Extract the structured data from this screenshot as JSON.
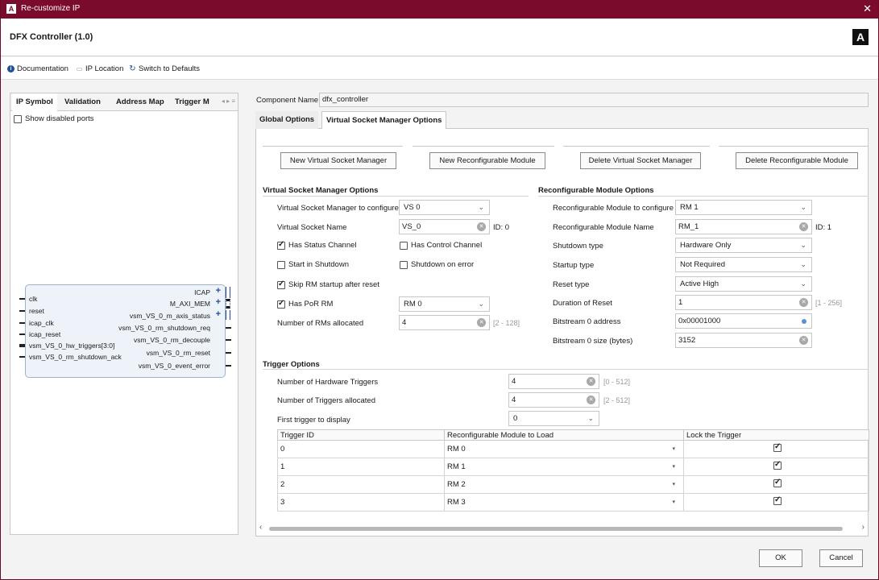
{
  "window": {
    "title": "Re-customize IP",
    "app_icon_glyph": "A"
  },
  "header": {
    "title": "DFX Controller (1.0)",
    "logo_glyph": "A"
  },
  "toolbar": {
    "documentation": "Documentation",
    "ip_location": "IP Location",
    "switch_defaults": "Switch to Defaults"
  },
  "left": {
    "tabs": [
      "IP Symbol",
      "Validation",
      "Address Map",
      "Trigger M"
    ],
    "show_disabled_ports": "Show disabled ports",
    "ports_left": [
      "clk",
      "reset",
      "icap_clk",
      "icap_reset",
      "vsm_VS_0_hw_triggers[3:0]",
      "vsm_VS_0_rm_shutdown_ack"
    ],
    "ports_right": [
      "ICAP",
      "M_AXI_MEM",
      "vsm_VS_0_m_axis_status",
      "vsm_VS_0_rm_shutdown_req",
      "vsm_VS_0_rm_decouple",
      "vsm_VS_0_rm_reset",
      "vsm_VS_0_event_error"
    ]
  },
  "right": {
    "component_name_label": "Component Name",
    "component_name_value": "dfx_controller",
    "tabs": [
      "Global Options",
      "Virtual Socket Manager Options"
    ],
    "buttons": [
      "New Virtual Socket Manager",
      "New Reconfigurable Module",
      "Delete Virtual Socket Manager",
      "Delete Reconfigurable Module"
    ],
    "vsm": {
      "title": "Virtual Socket Manager Options",
      "configure_label": "Virtual Socket Manager to configure",
      "configure_value": "VS 0",
      "name_label": "Virtual Socket Name",
      "name_value": "VS_0",
      "id_text": "ID: 0",
      "has_status_channel": "Has Status Channel",
      "has_control_channel": "Has Control Channel",
      "start_in_shutdown": "Start in Shutdown",
      "shutdown_on_error": "Shutdown on error",
      "skip_rm_startup": "Skip RM startup after reset",
      "has_por_rm": "Has PoR RM",
      "por_rm_value": "RM 0",
      "num_rms_label": "Number of RMs allocated",
      "num_rms_value": "4",
      "num_rms_hint": "[2 - 128]"
    },
    "rm": {
      "title": "Reconfigurable Module Options",
      "configure_label": "Reconfigurable Module to configure",
      "configure_value": "RM 1",
      "name_label": "Reconfigurable Module Name",
      "name_value": "RM_1",
      "id_text": "ID: 1",
      "shutdown_type_label": "Shutdown type",
      "shutdown_type_value": "Hardware Only",
      "startup_type_label": "Startup type",
      "startup_type_value": "Not Required",
      "reset_type_label": "Reset type",
      "reset_type_value": "Active High",
      "duration_label": "Duration of Reset",
      "duration_value": "1",
      "duration_hint": "[1 - 256]",
      "bs0_addr_label": "Bitstream 0 address",
      "bs0_addr_value": "0x00001000",
      "bs0_size_label": "Bitstream 0 size (bytes)",
      "bs0_size_value": "3152"
    },
    "trigger": {
      "title": "Trigger Options",
      "hw_label": "Number of Hardware Triggers",
      "hw_value": "4",
      "hw_hint": "[0 - 512]",
      "alloc_label": "Number of Triggers allocated",
      "alloc_value": "4",
      "alloc_hint": "[2 - 512]",
      "first_label": "First trigger to display",
      "first_value": "0",
      "columns": [
        "Trigger ID",
        "Reconfigurable Module to Load",
        "Lock the Trigger"
      ],
      "rows": [
        {
          "id": "0",
          "rm": "RM 0"
        },
        {
          "id": "1",
          "rm": "RM 1"
        },
        {
          "id": "2",
          "rm": "RM 2"
        },
        {
          "id": "3",
          "rm": "RM 3"
        }
      ]
    }
  },
  "footer": {
    "ok": "OK",
    "cancel": "Cancel"
  }
}
